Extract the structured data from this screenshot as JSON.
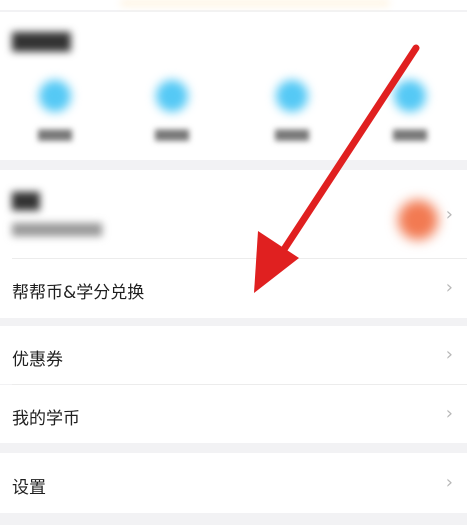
{
  "menu": {
    "items": [
      {
        "label": "帮帮币&学分兑换",
        "chevron": "›"
      },
      {
        "label": "优惠券",
        "chevron": "›"
      },
      {
        "label": "我的学币",
        "chevron": "›"
      },
      {
        "label": "设置",
        "chevron": "›"
      }
    ]
  },
  "blurred": {
    "row_chevron": "›"
  },
  "annotation": {
    "arrow_color": "#e02020"
  }
}
